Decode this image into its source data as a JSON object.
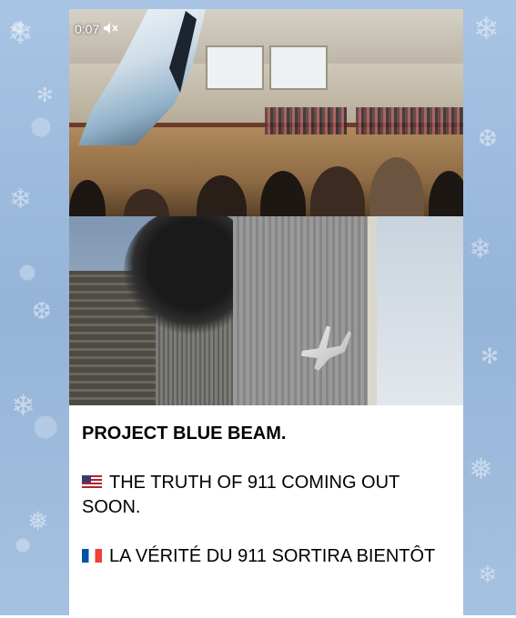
{
  "video": {
    "duration": "0:07",
    "mute_icon": "muted-speaker-icon"
  },
  "images": {
    "video_description_icon": "video-thumbnail",
    "photo_description_icon": "photo-thumbnail"
  },
  "caption": {
    "title": "PROJECT BLUE BEAM.",
    "line_en_flag": "us-flag-icon",
    "line_en": "THE TRUTH OF 911 COMING OUT SOON.",
    "line_fr_flag": "france-flag-icon",
    "line_fr": "LA VÉRITÉ DU 911 SORTIRA BIENTÔT"
  },
  "colors": {
    "wallpaper": "#9fbcdc",
    "bubble": "#ffffff",
    "text": "#000000"
  }
}
